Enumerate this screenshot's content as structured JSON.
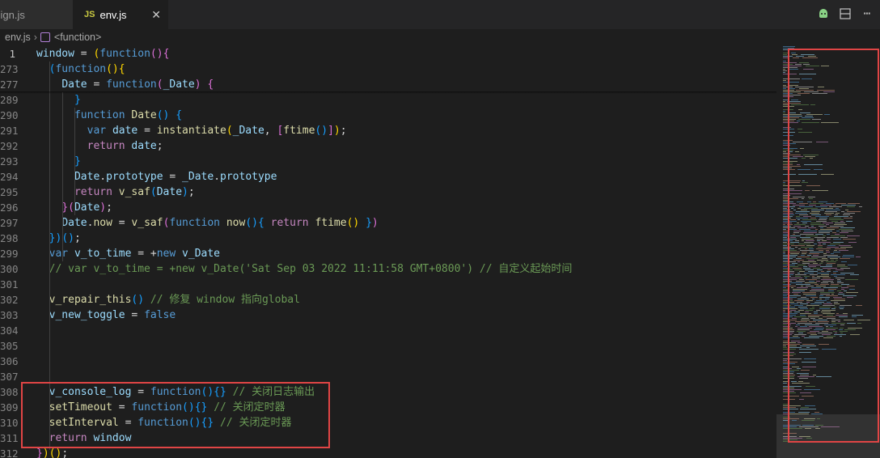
{
  "tabs": [
    {
      "label": "sign.js",
      "visible_label": "sign.js",
      "active": false
    },
    {
      "label": "env.js",
      "badge": "JS",
      "active": true
    }
  ],
  "tab_actions": [
    "run-icon",
    "split-editor-icon",
    "more-actions-icon"
  ],
  "breadcrumb": {
    "file": "env.js",
    "symbol": "<function>"
  },
  "colors": {
    "highlight_box": "#e04545",
    "background": "#1e1e1e"
  },
  "lines": [
    {
      "n": "1",
      "tokens": [
        [
          "var",
          "window"
        ],
        [
          "plain",
          " = "
        ],
        [
          "p1",
          "("
        ],
        [
          "kw",
          "function"
        ],
        [
          "p2",
          "()"
        ],
        [
          "p2",
          "{"
        ]
      ]
    },
    {
      "n": "273",
      "tokens": [
        [
          "plain",
          "  "
        ],
        [
          "p3",
          "("
        ],
        [
          "kw",
          "function"
        ],
        [
          "p1",
          "()"
        ],
        [
          "p1",
          "{"
        ]
      ]
    },
    {
      "n": "277",
      "tokens": [
        [
          "plain",
          "    "
        ],
        [
          "var",
          "Date"
        ],
        [
          "plain",
          " = "
        ],
        [
          "kw",
          "function"
        ],
        [
          "p2",
          "("
        ],
        [
          "var",
          "_Date"
        ],
        [
          "p2",
          ")"
        ],
        [
          "plain",
          " "
        ],
        [
          "p2",
          "{"
        ]
      ]
    },
    {
      "n": "289",
      "tokens": [
        [
          "plain",
          "      "
        ],
        [
          "p3",
          "}"
        ]
      ]
    },
    {
      "n": "290",
      "tokens": [
        [
          "plain",
          "      "
        ],
        [
          "kw",
          "function"
        ],
        [
          "plain",
          " "
        ],
        [
          "fn",
          "Date"
        ],
        [
          "p3",
          "()"
        ],
        [
          "plain",
          " "
        ],
        [
          "p3",
          "{"
        ]
      ]
    },
    {
      "n": "291",
      "tokens": [
        [
          "plain",
          "        "
        ],
        [
          "kw",
          "var"
        ],
        [
          "plain",
          " "
        ],
        [
          "var",
          "date"
        ],
        [
          "plain",
          " = "
        ],
        [
          "fn",
          "instantiate"
        ],
        [
          "p1",
          "("
        ],
        [
          "var",
          "_Date"
        ],
        [
          "plain",
          ", "
        ],
        [
          "p2",
          "["
        ],
        [
          "fn",
          "ftime"
        ],
        [
          "p3",
          "()"
        ],
        [
          "p2",
          "]"
        ],
        [
          "p1",
          ")"
        ],
        [
          "plain",
          ";"
        ]
      ]
    },
    {
      "n": "292",
      "tokens": [
        [
          "plain",
          "        "
        ],
        [
          "ctl",
          "return"
        ],
        [
          "plain",
          " "
        ],
        [
          "var",
          "date"
        ],
        [
          "plain",
          ";"
        ]
      ]
    },
    {
      "n": "293",
      "tokens": [
        [
          "plain",
          "      "
        ],
        [
          "p3",
          "}"
        ]
      ]
    },
    {
      "n": "294",
      "tokens": [
        [
          "plain",
          "      "
        ],
        [
          "var",
          "Date"
        ],
        [
          "plain",
          "."
        ],
        [
          "var",
          "prototype"
        ],
        [
          "plain",
          " = "
        ],
        [
          "var",
          "_Date"
        ],
        [
          "plain",
          "."
        ],
        [
          "var",
          "prototype"
        ]
      ]
    },
    {
      "n": "295",
      "tokens": [
        [
          "plain",
          "      "
        ],
        [
          "ctl",
          "return"
        ],
        [
          "plain",
          " "
        ],
        [
          "fn",
          "v_saf"
        ],
        [
          "p3",
          "("
        ],
        [
          "var",
          "Date"
        ],
        [
          "p3",
          ")"
        ],
        [
          "plain",
          ";"
        ]
      ]
    },
    {
      "n": "296",
      "tokens": [
        [
          "plain",
          "    "
        ],
        [
          "p2",
          "}"
        ],
        [
          "p2",
          "("
        ],
        [
          "var",
          "Date"
        ],
        [
          "p2",
          ")"
        ],
        [
          "plain",
          ";"
        ]
      ]
    },
    {
      "n": "297",
      "tokens": [
        [
          "plain",
          "    "
        ],
        [
          "var",
          "Date"
        ],
        [
          "plain",
          "."
        ],
        [
          "fn",
          "now"
        ],
        [
          "plain",
          " = "
        ],
        [
          "fn",
          "v_saf"
        ],
        [
          "p2",
          "("
        ],
        [
          "kw",
          "function"
        ],
        [
          "plain",
          " "
        ],
        [
          "fn",
          "now"
        ],
        [
          "p3",
          "()"
        ],
        [
          "p3",
          "{"
        ],
        [
          "plain",
          " "
        ],
        [
          "ctl",
          "return"
        ],
        [
          "plain",
          " "
        ],
        [
          "fn",
          "ftime"
        ],
        [
          "p1",
          "()"
        ],
        [
          "plain",
          " "
        ],
        [
          "p3",
          "}"
        ],
        [
          "p2",
          ")"
        ]
      ]
    },
    {
      "n": "298",
      "tokens": [
        [
          "plain",
          "  "
        ],
        [
          "p3",
          "})"
        ],
        [
          "p3",
          "()"
        ],
        [
          "plain",
          ";"
        ]
      ]
    },
    {
      "n": "299",
      "tokens": [
        [
          "plain",
          "  "
        ],
        [
          "kw",
          "var"
        ],
        [
          "plain",
          " "
        ],
        [
          "var",
          "v_to_time"
        ],
        [
          "plain",
          " = +"
        ],
        [
          "kw",
          "new"
        ],
        [
          "plain",
          " "
        ],
        [
          "var",
          "v_Date"
        ]
      ]
    },
    {
      "n": "300",
      "tokens": [
        [
          "plain",
          "  "
        ],
        [
          "cmt",
          "// var v_to_time = +new v_Date('Sat Sep 03 2022 11:11:58 GMT+0800') // 自定义起始时间"
        ]
      ]
    },
    {
      "n": "301",
      "tokens": []
    },
    {
      "n": "302",
      "tokens": [
        [
          "plain",
          "  "
        ],
        [
          "fn",
          "v_repair_this"
        ],
        [
          "p3",
          "()"
        ],
        [
          "plain",
          " "
        ],
        [
          "cmt",
          "// 修复 window 指向global"
        ]
      ]
    },
    {
      "n": "303",
      "tokens": [
        [
          "plain",
          "  "
        ],
        [
          "var",
          "v_new_toggle"
        ],
        [
          "plain",
          " = "
        ],
        [
          "kw",
          "false"
        ]
      ]
    },
    {
      "n": "304",
      "tokens": []
    },
    {
      "n": "305",
      "tokens": []
    },
    {
      "n": "306",
      "tokens": []
    },
    {
      "n": "307",
      "tokens": []
    },
    {
      "n": "308",
      "tokens": [
        [
          "plain",
          "  "
        ],
        [
          "var",
          "v_console_log"
        ],
        [
          "plain",
          " = "
        ],
        [
          "kw",
          "function"
        ],
        [
          "p3",
          "()"
        ],
        [
          "p3",
          "{}"
        ],
        [
          "plain",
          " "
        ],
        [
          "cmt",
          "// 关闭日志输出"
        ]
      ]
    },
    {
      "n": "309",
      "tokens": [
        [
          "plain",
          "  "
        ],
        [
          "fn",
          "setTimeout"
        ],
        [
          "plain",
          " = "
        ],
        [
          "kw",
          "function"
        ],
        [
          "p3",
          "()"
        ],
        [
          "p3",
          "{}"
        ],
        [
          "plain",
          " "
        ],
        [
          "cmt",
          "// 关闭定时器"
        ]
      ]
    },
    {
      "n": "310",
      "tokens": [
        [
          "plain",
          "  "
        ],
        [
          "fn",
          "setInterval"
        ],
        [
          "plain",
          " = "
        ],
        [
          "kw",
          "function"
        ],
        [
          "p3",
          "()"
        ],
        [
          "p3",
          "{}"
        ],
        [
          "plain",
          " "
        ],
        [
          "cmt",
          "// 关闭定时器"
        ]
      ]
    },
    {
      "n": "311",
      "tokens": [
        [
          "plain",
          "  "
        ],
        [
          "ctl",
          "return"
        ],
        [
          "plain",
          " "
        ],
        [
          "var",
          "window"
        ]
      ]
    },
    {
      "n": "312",
      "tokens": [
        [
          "p2",
          "}"
        ],
        [
          "p1",
          ")"
        ],
        [
          "p1",
          "()"
        ],
        [
          "plain",
          ";"
        ]
      ]
    }
  ]
}
